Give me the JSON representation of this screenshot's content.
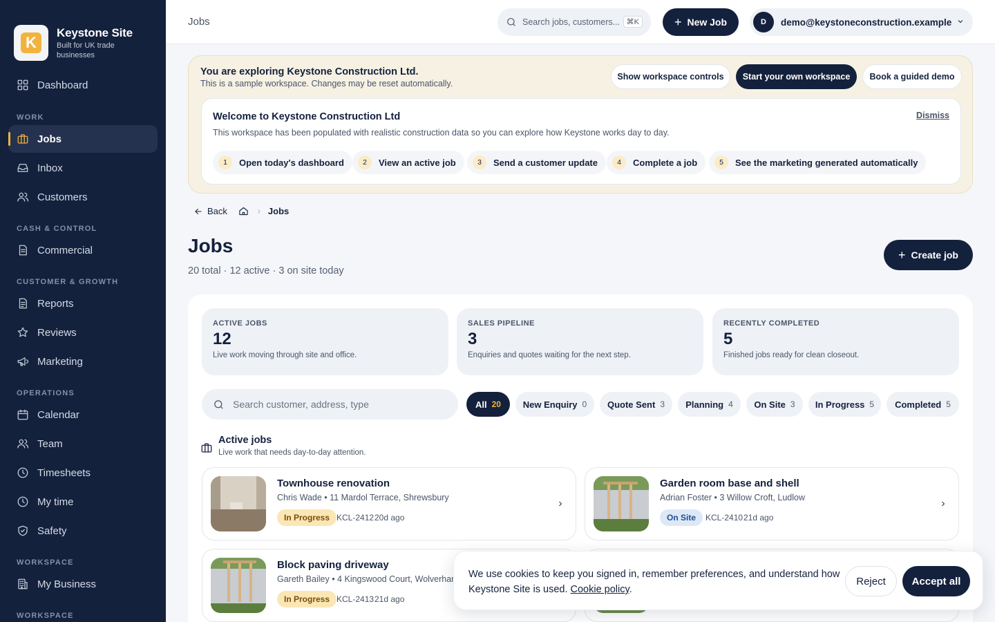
{
  "brand": {
    "logo_letter": "K",
    "name": "Keystone Site",
    "tagline": "Built for UK trade businesses",
    "accent_color": "#f2b33d",
    "navy": "#14213d"
  },
  "sidebar": {
    "dashboard": "Dashboard",
    "sections": [
      "WORK",
      "CASH & CONTROL",
      "CUSTOMER & GROWTH",
      "OPERATIONS",
      "WORKSPACE",
      "WORKSPACE"
    ],
    "items": [
      {
        "label": "Jobs",
        "icon": "briefcase-icon",
        "active": true
      },
      {
        "label": "Inbox",
        "icon": "inbox-icon"
      },
      {
        "label": "Customers",
        "icon": "users-icon"
      },
      {
        "label": "Commercial",
        "icon": "document-icon"
      },
      {
        "label": "Reports",
        "icon": "report-icon"
      },
      {
        "label": "Reviews",
        "icon": "star-icon"
      },
      {
        "label": "Marketing",
        "icon": "megaphone-icon"
      },
      {
        "label": "Calendar",
        "icon": "calendar-icon"
      },
      {
        "label": "Team",
        "icon": "team-icon"
      },
      {
        "label": "Timesheets",
        "icon": "clock-icon"
      },
      {
        "label": "My time",
        "icon": "clock-icon"
      },
      {
        "label": "Safety",
        "icon": "shield-icon"
      },
      {
        "label": "My Business",
        "icon": "building-icon"
      }
    ]
  },
  "topbar": {
    "title": "Jobs",
    "search_placeholder": "Search jobs, customers...",
    "shortcut": "⌘K",
    "new_job": "New Job",
    "user_initial": "D",
    "user_email": "demo@keystoneconstruction.example"
  },
  "demo": {
    "title": "You are exploring Keystone Construction Ltd.",
    "subtitle": "This is a sample workspace. Changes may be reset automatically.",
    "btn_controls": "Show workspace controls",
    "btn_start": "Start your own workspace",
    "btn_demo": "Book a guided demo",
    "welcome_title": "Welcome to Keystone Construction Ltd",
    "welcome_sub": "This workspace has been populated with realistic construction data so you can explore how Keystone works day to day.",
    "dismiss": "Dismiss",
    "steps": [
      {
        "num": "1",
        "label": "Open today's dashboard"
      },
      {
        "num": "2",
        "label": "View an active job"
      },
      {
        "num": "3",
        "label": "Send a customer update"
      },
      {
        "num": "4",
        "label": "Complete a job"
      },
      {
        "num": "5",
        "label": "See the marketing generated automatically"
      }
    ]
  },
  "breadcrumb": {
    "back": "Back",
    "current": "Jobs"
  },
  "page": {
    "title": "Jobs",
    "subtitle": "20 total · 12 active · 3 on site today",
    "create_button": "Create job"
  },
  "stats": [
    {
      "label": "ACTIVE JOBS",
      "value": "12",
      "desc": "Live work moving through site and office."
    },
    {
      "label": "SALES PIPELINE",
      "value": "3",
      "desc": "Enquiries and quotes waiting for the next step."
    },
    {
      "label": "RECENTLY COMPLETED",
      "value": "5",
      "desc": "Finished jobs ready for clean closeout."
    }
  ],
  "filters": {
    "search_placeholder": "Search customer, address, type",
    "chips": [
      {
        "label": "All",
        "count": "20",
        "active": true
      },
      {
        "label": "New Enquiry",
        "count": "0"
      },
      {
        "label": "Quote Sent",
        "count": "3"
      },
      {
        "label": "Planning",
        "count": "4"
      },
      {
        "label": "On Site",
        "count": "3"
      },
      {
        "label": "In Progress",
        "count": "5"
      },
      {
        "label": "Completed",
        "count": "5"
      }
    ]
  },
  "active_group": {
    "title": "Active jobs",
    "subtitle": "Live work that needs day-to-day attention."
  },
  "jobs": [
    {
      "title": "Townhouse renovation",
      "meta": "Chris Wade • 11 Mardol Terrace, Shrewsbury",
      "status": "In Progress",
      "ref": "KCL-2412",
      "age": "20d ago"
    },
    {
      "title": "Garden room base and shell",
      "meta": "Adrian Foster • 3 Willow Croft, Ludlow",
      "status": "On Site",
      "ref": "KCL-2410",
      "age": "21d ago"
    },
    {
      "title": "Block paving driveway",
      "meta": "Gareth Bailey • 4 Kingswood Court, Wolverhampton",
      "status": "In Progress",
      "ref": "KCL-2413",
      "age": "21d ago"
    }
  ],
  "cookie": {
    "text": "We use cookies to keep you signed in, remember preferences, and understand how Keystone Site is used.",
    "link": "Cookie policy",
    "reject": "Reject",
    "accept": "Accept all"
  }
}
